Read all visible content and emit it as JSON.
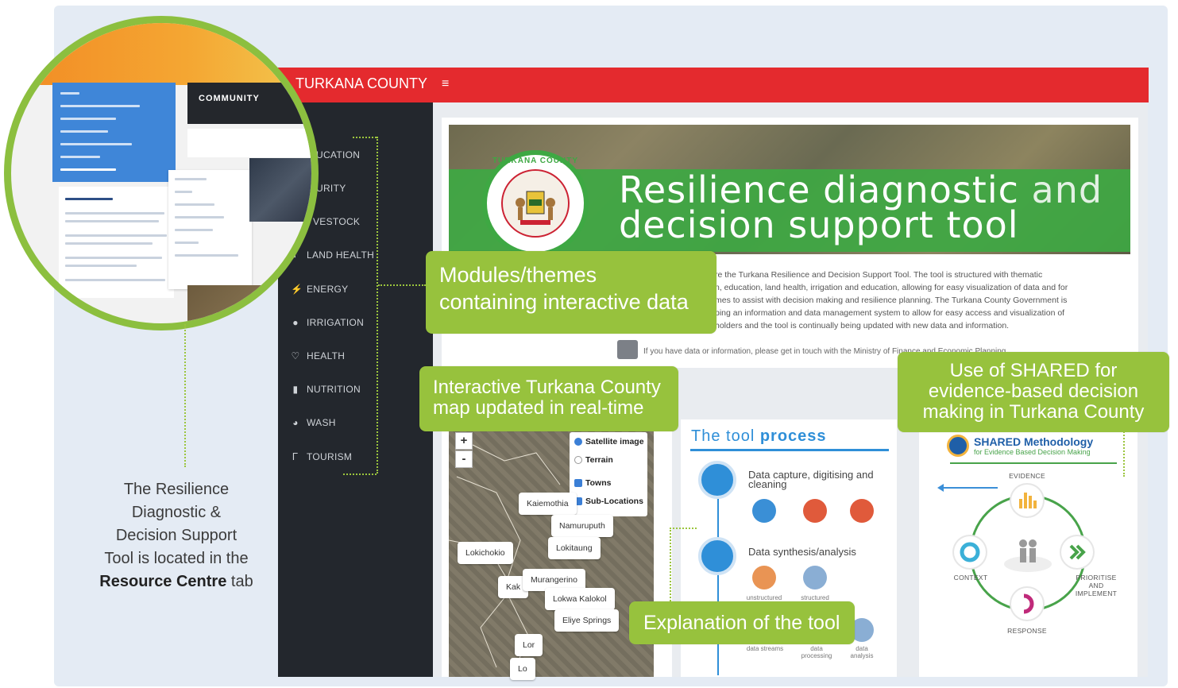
{
  "header": {
    "brand": "TURKANA COUNTY",
    "menu_icon": "hamburger-icon",
    "accent_color": "#e42a2e"
  },
  "sidebar": {
    "items": [
      {
        "label": "EDUCATION",
        "visible_text": "UCATION",
        "icon": "book-icon"
      },
      {
        "label": "SECURITY",
        "visible_text": "URITY",
        "icon": "shield-icon"
      },
      {
        "label": "LIVESTOCK",
        "visible_text": "VESTOCK",
        "icon": "cow-icon"
      },
      {
        "label": "LAND HEALTH",
        "icon": "land-icon"
      },
      {
        "label": "ENERGY",
        "icon": "bolt-icon"
      },
      {
        "label": "IRRIGATION",
        "icon": "drop-icon"
      },
      {
        "label": "HEALTH",
        "icon": "heart-icon"
      },
      {
        "label": "NUTRITION",
        "icon": "bottle-icon"
      },
      {
        "label": "WASH",
        "icon": "pie-icon"
      },
      {
        "label": "TOURISM",
        "icon": "binoculars-icon"
      }
    ]
  },
  "banner": {
    "title_line1_a": "Resilience diagnostic",
    "title_line1_b": " and",
    "title_line2": "decision support tool",
    "seal_text": "TURKANA COUNTY"
  },
  "intro": {
    "lines": [
      "re the Turkana Resilience and Decision Support Tool. The tool is structured with thematic",
      "n, education, land health, irrigation and education, allowing for easy visualization of data and for",
      "mes to assist with decision making and resilience planning. The Turkana County Government is",
      "ping an information and data management system to allow for easy access and visualization of",
      "holders and the tool is continually being updated with new data and information."
    ],
    "contact": "If you have data or information, please get in touch with the Ministry of Finance and Economic Planning"
  },
  "map": {
    "zoom_in": "+",
    "zoom_out": "-",
    "layers": [
      {
        "label": "Satellite image",
        "checked": true,
        "kind": "radio"
      },
      {
        "label": "Terrain",
        "checked": false,
        "kind": "radio"
      },
      {
        "label": "Towns",
        "checked": true,
        "kind": "checkbox"
      },
      {
        "label": "Sub-Locations",
        "checked": true,
        "kind": "checkbox"
      }
    ],
    "places": [
      "Kaiemothia",
      "Namuruputh",
      "Lokitaung",
      "Lokichokio",
      "Kak",
      "Murangerino",
      "Lokwa Kalokol",
      "Eliye Springs",
      "Lor",
      "Lo"
    ]
  },
  "process": {
    "title_light": "The tool ",
    "title_bold": "process",
    "step1": "Data capture, digitising and cleaning",
    "step2": "Data synthesis/analysis",
    "sub_a": "unstructured",
    "sub_b": "structured",
    "bottom_labels": [
      "data streams",
      "data processing",
      "data analysis"
    ]
  },
  "shared": {
    "title": "SHARED Methodology",
    "subtitle": "for Evidence Based Decision Making",
    "evidence": "EVIDENCE",
    "context": "CONTEXT",
    "prioritise": "PRIORITISE AND IMPLEMENT",
    "response": "RESPONSE"
  },
  "callouts": {
    "modules": [
      "Modules/themes",
      "containing interactive data"
    ],
    "map": [
      "Interactive Turkana County",
      "map updated in real-time"
    ],
    "shared": [
      "Use of SHARED for",
      "evidence-based decision",
      "making in Turkana County"
    ],
    "explanation": "Explanation of the tool",
    "callout_color": "#97c23d"
  },
  "resource_note": {
    "lines": [
      "The Resilience",
      "Diagnostic &",
      "Decision Support",
      "Tool is located in the"
    ],
    "bold": "Resource Centre",
    "tail": " tab"
  },
  "magnifier": {
    "community_label": "COMMUNITY"
  }
}
